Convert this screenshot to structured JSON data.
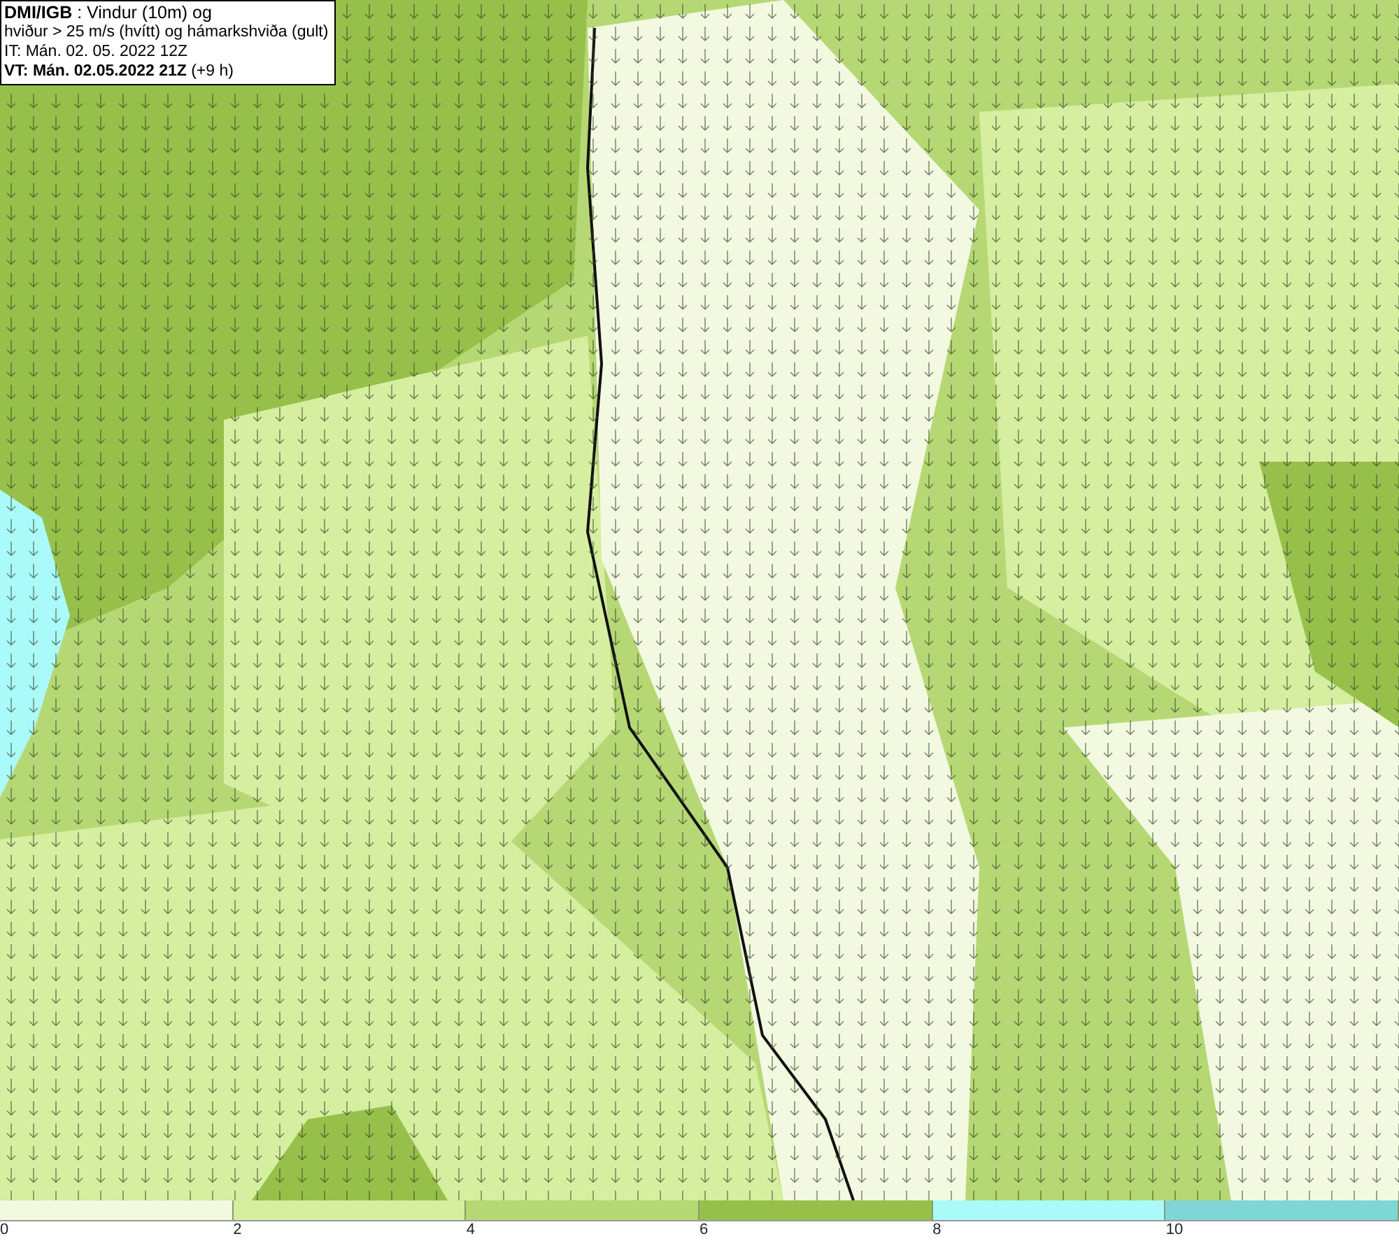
{
  "title_box": {
    "lines": [
      "**DMI/IGB** : Vindur (10m) og",
      "hviður > 25 m/s (hvítt) og hámarkshviða (gult)",
      "IT: Mán. 02. 05. 2022 12Z",
      "**VT: Mán. 02.05.2022 21Z** (+9 h)"
    ]
  },
  "legend": [
    {
      "label": "0",
      "color": "#f2f9e0"
    },
    {
      "label": "2",
      "color": "#d6eea0"
    },
    {
      "label": "4",
      "color": "#b6d874"
    },
    {
      "label": "6",
      "color": "#96c04a"
    },
    {
      "label": "8",
      "color": "#aafafa"
    },
    {
      "label": "10",
      "color": "#7fd6d6"
    }
  ]
}
